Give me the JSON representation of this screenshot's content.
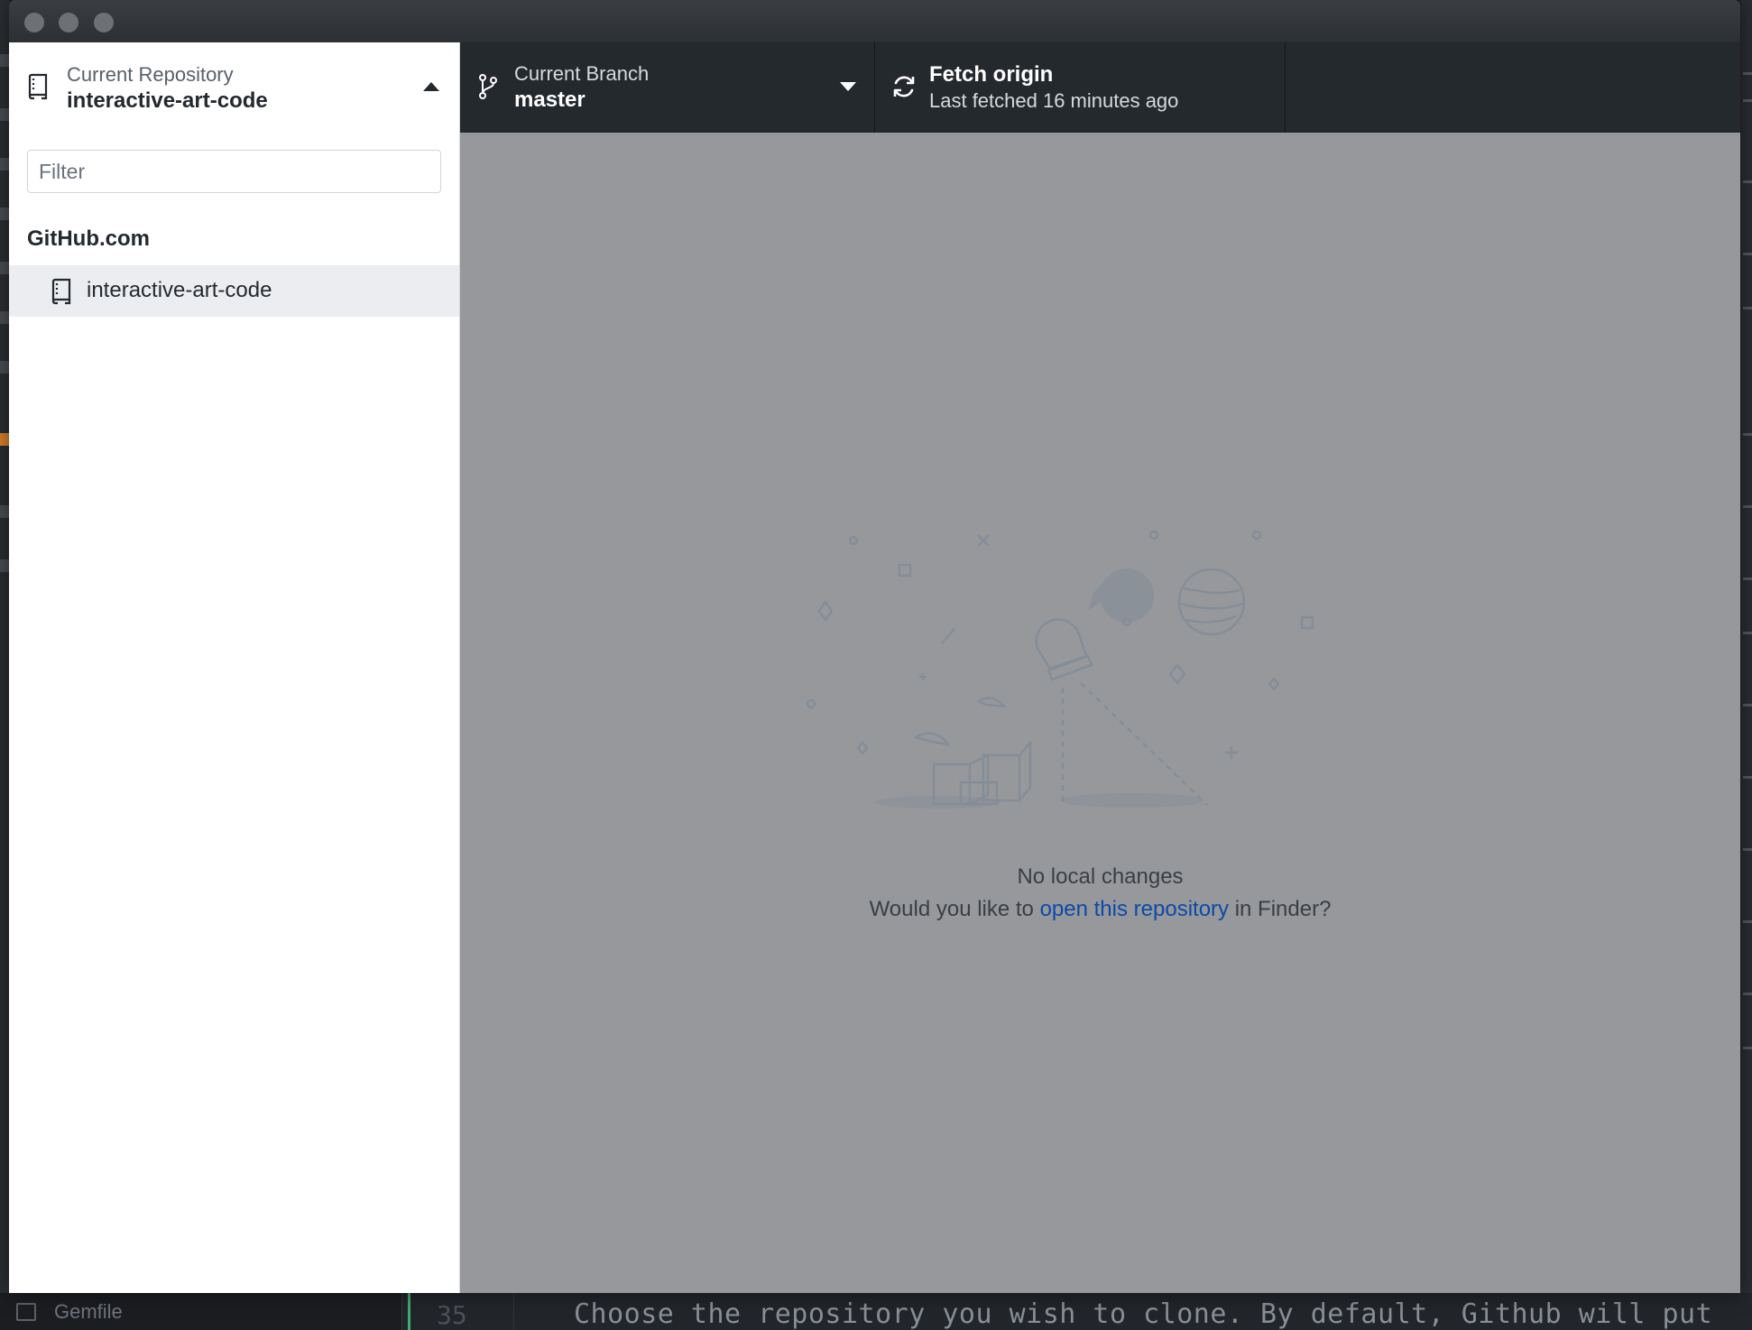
{
  "window": {
    "controls": [
      "close",
      "minimize",
      "zoom"
    ]
  },
  "repository_selector": {
    "label": "Current Repository",
    "value": "interactive-art-code",
    "icon": "repo-icon"
  },
  "branch_selector": {
    "label": "Current Branch",
    "value": "master",
    "icon": "git-branch-icon"
  },
  "fetch_button": {
    "label": "Fetch origin",
    "status": "Last fetched 16 minutes ago",
    "icon": "sync-icon"
  },
  "repo_list": {
    "filter_placeholder": "Filter",
    "filter_value": "",
    "groups": [
      {
        "name": "GitHub.com",
        "items": [
          {
            "label": "interactive-art-code",
            "selected": true
          }
        ]
      }
    ]
  },
  "empty_state": {
    "title": "No local changes",
    "desc_prefix": "Would you like to ",
    "desc_link": "open this repository",
    "desc_suffix": " in Finder?"
  },
  "background_editor": {
    "file_tab_label": "Gemfile",
    "line_number": "35",
    "code_line": "Choose the repository you wish to clone. By default, Github will put"
  },
  "colors": {
    "toolbar_bg": "#24292e",
    "panel_bg": "#ffffff",
    "selected_item_bg": "#ebedf0",
    "overlay_bg": "#96989b",
    "link": "#0b4aa8"
  }
}
